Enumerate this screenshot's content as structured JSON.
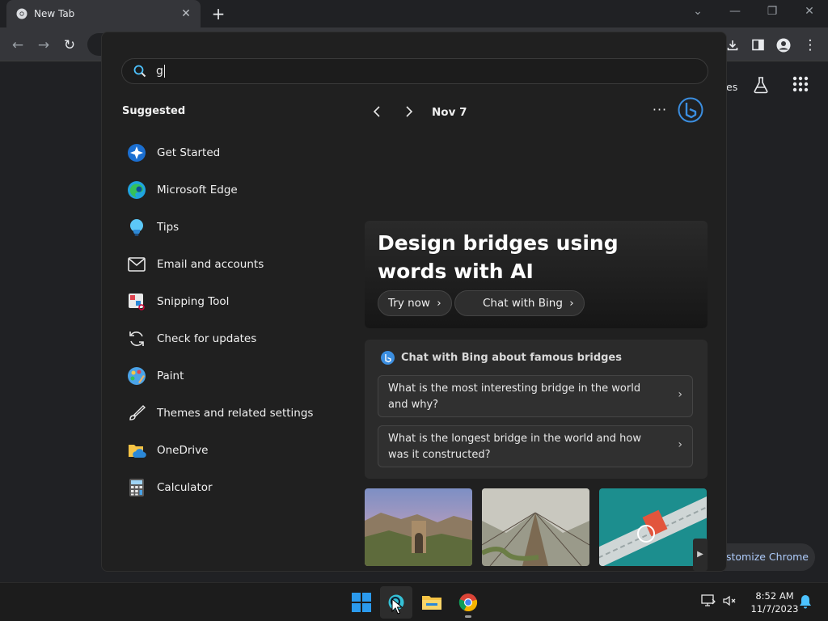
{
  "browser": {
    "tab_title": "New Tab",
    "tab_close": "✕",
    "new_tab": "+",
    "window_controls": [
      "⌄",
      "—",
      "❐",
      "✕"
    ]
  },
  "ntp": {
    "partial_label": "es",
    "customize_label": "stomize Chrome"
  },
  "start_menu": {
    "search_value": "g",
    "suggested_title": "Suggested",
    "suggested": [
      {
        "label": "Get Started",
        "icon": "get-started-icon"
      },
      {
        "label": "Microsoft Edge",
        "icon": "edge-icon"
      },
      {
        "label": "Tips",
        "icon": "lightbulb-icon"
      },
      {
        "label": "Email and accounts",
        "icon": "mail-icon"
      },
      {
        "label": "Snipping Tool",
        "icon": "snipping-tool-icon"
      },
      {
        "label": "Check for updates",
        "icon": "refresh-icon"
      },
      {
        "label": "Paint",
        "icon": "palette-icon"
      },
      {
        "label": "Themes and related settings",
        "icon": "brush-icon"
      },
      {
        "label": "OneDrive",
        "icon": "folder-cloud-icon"
      },
      {
        "label": "Calculator",
        "icon": "calculator-icon"
      }
    ],
    "date_label": "Nov 7",
    "more_label": "···",
    "hero": {
      "title": "Design bridges using words with AI",
      "try_label": "Try now",
      "chat_label": "Chat with Bing"
    },
    "chat_card": {
      "title": "Chat with Bing about famous bridges",
      "questions": [
        "What is the most interesting bridge in the world and why?",
        "What is the longest bridge in the world and how was it constructed?"
      ]
    }
  },
  "taskbar": {
    "time": "8:52 AM",
    "date": "11/7/2023"
  },
  "colors": {
    "accent": "#3b8ee0",
    "start_bg": "#202020",
    "taskbar_bg": "#1c1c1c"
  }
}
